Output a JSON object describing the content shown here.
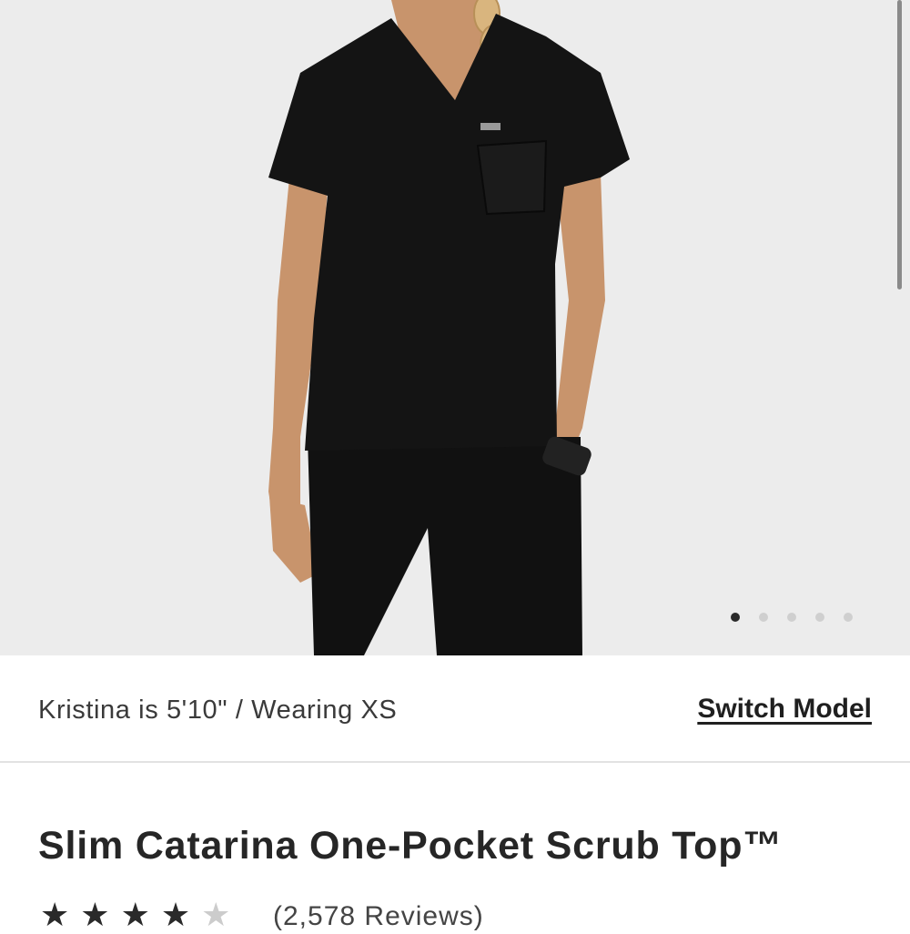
{
  "hero": {
    "image_alt": "Model wearing black scrub top and pants",
    "carousel_count": 5,
    "carousel_active_index": 0
  },
  "model_info": {
    "text": "Kristina is 5'10\" / Wearing XS",
    "switch_label": "Switch Model"
  },
  "product": {
    "title": "Slim Catarina One-Pocket Scrub Top™",
    "rating": 4.5,
    "stars": [
      "★",
      "★",
      "★",
      "★",
      "★"
    ],
    "reviews_text": "(2,578 Reviews)"
  },
  "colors": {
    "accent": "#1f1f1f",
    "background": "#ffffff",
    "hero_bg": "#ececec",
    "garment": "#111111"
  }
}
